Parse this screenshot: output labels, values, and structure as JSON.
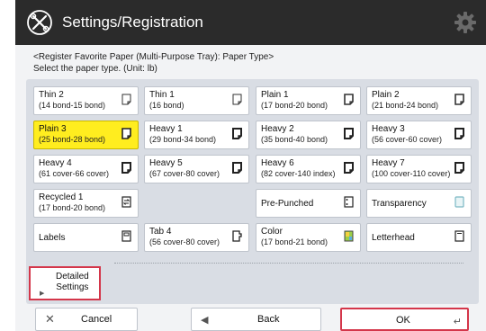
{
  "header": {
    "title": "Settings/Registration",
    "title_icon": "wrench-screwdriver-icon",
    "settings_icon": "gear-icon"
  },
  "instructions": {
    "line1": "<Register Favorite Paper (Multi-Purpose Tray): Paper Type>",
    "line2": "Select the paper type. (Unit: lb)"
  },
  "paper_types": [
    {
      "name": "Thin 2",
      "spec": "(14 bond-15 bond)"
    },
    {
      "name": "Thin 1",
      "spec": "(16 bond)"
    },
    {
      "name": "Plain 1",
      "spec": "(17 bond-20 bond)"
    },
    {
      "name": "Plain 2",
      "spec": "(21 bond-24 bond)"
    },
    {
      "name": "Plain 3",
      "spec": "(25 bond-28 bond)"
    },
    {
      "name": "Heavy 1",
      "spec": "(29 bond-34 bond)"
    },
    {
      "name": "Heavy 2",
      "spec": "(35 bond-40 bond)"
    },
    {
      "name": "Heavy 3",
      "spec": "(56 cover-60 cover)"
    },
    {
      "name": "Heavy 4",
      "spec": "(61 cover-66 cover)"
    },
    {
      "name": "Heavy 5",
      "spec": "(67 cover-80 cover)"
    },
    {
      "name": "Heavy 6",
      "spec": "(82 cover-140 index)"
    },
    {
      "name": "Heavy 7",
      "spec": "(100 cover-110 cover)"
    },
    {
      "name": "Recycled 1",
      "spec": "(17 bond-20 bond)"
    },
    {
      "name": "Pre-Punched"
    },
    {
      "name": "Transparency"
    },
    {
      "name": "Labels"
    },
    {
      "name": "Tab 4",
      "spec": "(56 cover-80 cover)"
    },
    {
      "name": "Color",
      "spec": "(17 bond-21 bond)"
    },
    {
      "name": "Letterhead"
    }
  ],
  "selected_paper": "Plain 3",
  "detailed_settings": {
    "line1": "Detailed",
    "line2": "Settings"
  },
  "footer": {
    "cancel_label": "Cancel",
    "back_label": "Back",
    "ok_label": "OK"
  },
  "colors": {
    "title_bar": "#2b2b2b",
    "selected_highlight": "#ffed1f",
    "callout_outline": "#d4364a"
  }
}
